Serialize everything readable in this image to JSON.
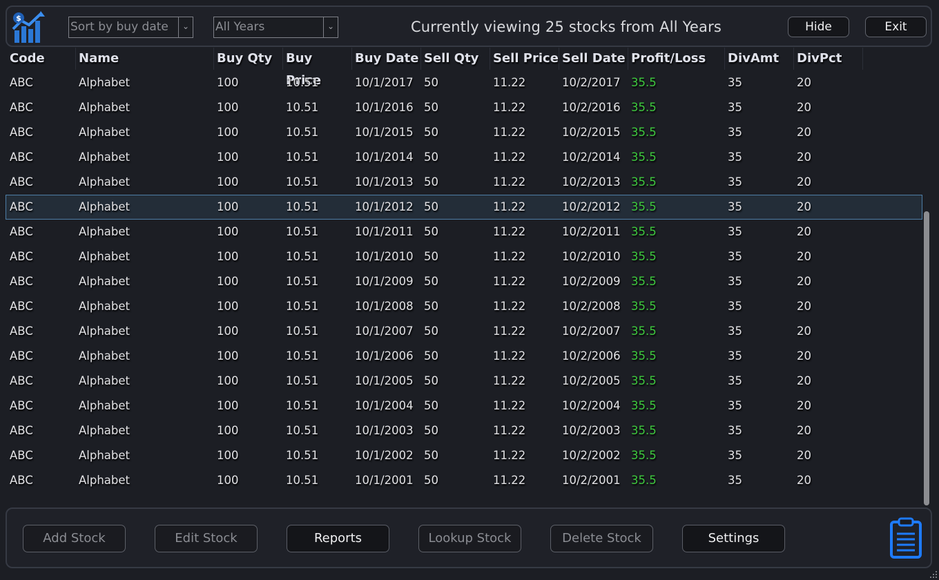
{
  "toolbar": {
    "sort_value": "Sort by buy date",
    "year_value": "All Years",
    "viewing_text": "Currently viewing 25 stocks from All Years",
    "hide_label": "Hide",
    "exit_label": "Exit"
  },
  "table": {
    "columns": [
      "Code",
      "Name",
      "Buy Qty",
      "Buy Price",
      "Buy Date",
      "Sell Qty",
      "Sell Price",
      "Sell Date",
      "Profit/Loss",
      "DivAmt",
      "DivPct"
    ],
    "rows": [
      [
        "ABC",
        "Alphabet",
        "100",
        "10.51",
        "10/1/2017",
        "50",
        "11.22",
        "10/2/2017",
        "35.5",
        "35",
        "20"
      ],
      [
        "ABC",
        "Alphabet",
        "100",
        "10.51",
        "10/1/2016",
        "50",
        "11.22",
        "10/2/2016",
        "35.5",
        "35",
        "20"
      ],
      [
        "ABC",
        "Alphabet",
        "100",
        "10.51",
        "10/1/2015",
        "50",
        "11.22",
        "10/2/2015",
        "35.5",
        "35",
        "20"
      ],
      [
        "ABC",
        "Alphabet",
        "100",
        "10.51",
        "10/1/2014",
        "50",
        "11.22",
        "10/2/2014",
        "35.5",
        "35",
        "20"
      ],
      [
        "ABC",
        "Alphabet",
        "100",
        "10.51",
        "10/1/2013",
        "50",
        "11.22",
        "10/2/2013",
        "35.5",
        "35",
        "20"
      ],
      [
        "ABC",
        "Alphabet",
        "100",
        "10.51",
        "10/1/2012",
        "50",
        "11.22",
        "10/2/2012",
        "35.5",
        "35",
        "20"
      ],
      [
        "ABC",
        "Alphabet",
        "100",
        "10.51",
        "10/1/2011",
        "50",
        "11.22",
        "10/2/2011",
        "35.5",
        "35",
        "20"
      ],
      [
        "ABC",
        "Alphabet",
        "100",
        "10.51",
        "10/1/2010",
        "50",
        "11.22",
        "10/2/2010",
        "35.5",
        "35",
        "20"
      ],
      [
        "ABC",
        "Alphabet",
        "100",
        "10.51",
        "10/1/2009",
        "50",
        "11.22",
        "10/2/2009",
        "35.5",
        "35",
        "20"
      ],
      [
        "ABC",
        "Alphabet",
        "100",
        "10.51",
        "10/1/2008",
        "50",
        "11.22",
        "10/2/2008",
        "35.5",
        "35",
        "20"
      ],
      [
        "ABC",
        "Alphabet",
        "100",
        "10.51",
        "10/1/2007",
        "50",
        "11.22",
        "10/2/2007",
        "35.5",
        "35",
        "20"
      ],
      [
        "ABC",
        "Alphabet",
        "100",
        "10.51",
        "10/1/2006",
        "50",
        "11.22",
        "10/2/2006",
        "35.5",
        "35",
        "20"
      ],
      [
        "ABC",
        "Alphabet",
        "100",
        "10.51",
        "10/1/2005",
        "50",
        "11.22",
        "10/2/2005",
        "35.5",
        "35",
        "20"
      ],
      [
        "ABC",
        "Alphabet",
        "100",
        "10.51",
        "10/1/2004",
        "50",
        "11.22",
        "10/2/2004",
        "35.5",
        "35",
        "20"
      ],
      [
        "ABC",
        "Alphabet",
        "100",
        "10.51",
        "10/1/2003",
        "50",
        "11.22",
        "10/2/2003",
        "35.5",
        "35",
        "20"
      ],
      [
        "ABC",
        "Alphabet",
        "100",
        "10.51",
        "10/1/2002",
        "50",
        "11.22",
        "10/2/2002",
        "35.5",
        "35",
        "20"
      ],
      [
        "ABC",
        "Alphabet",
        "100",
        "10.51",
        "10/1/2001",
        "50",
        "11.22",
        "10/2/2001",
        "35.5",
        "35",
        "20"
      ]
    ],
    "selected_row": 5,
    "profit_color": "#3ec93e",
    "selection_border_color": "#4e7ea6"
  },
  "bottom_buttons": [
    {
      "label": "Add Stock",
      "enabled": false
    },
    {
      "label": "Edit Stock",
      "enabled": false
    },
    {
      "label": "Reports",
      "enabled": true
    },
    {
      "label": "Lookup Stock",
      "enabled": false
    },
    {
      "label": "Delete Stock",
      "enabled": false
    },
    {
      "label": "Settings",
      "enabled": true
    }
  ],
  "icons": {
    "app": "stock-chart-icon",
    "dropdown": "chevron-down-icon",
    "clipboard": "clipboard-icon",
    "resize": "resize-grip-icon"
  }
}
